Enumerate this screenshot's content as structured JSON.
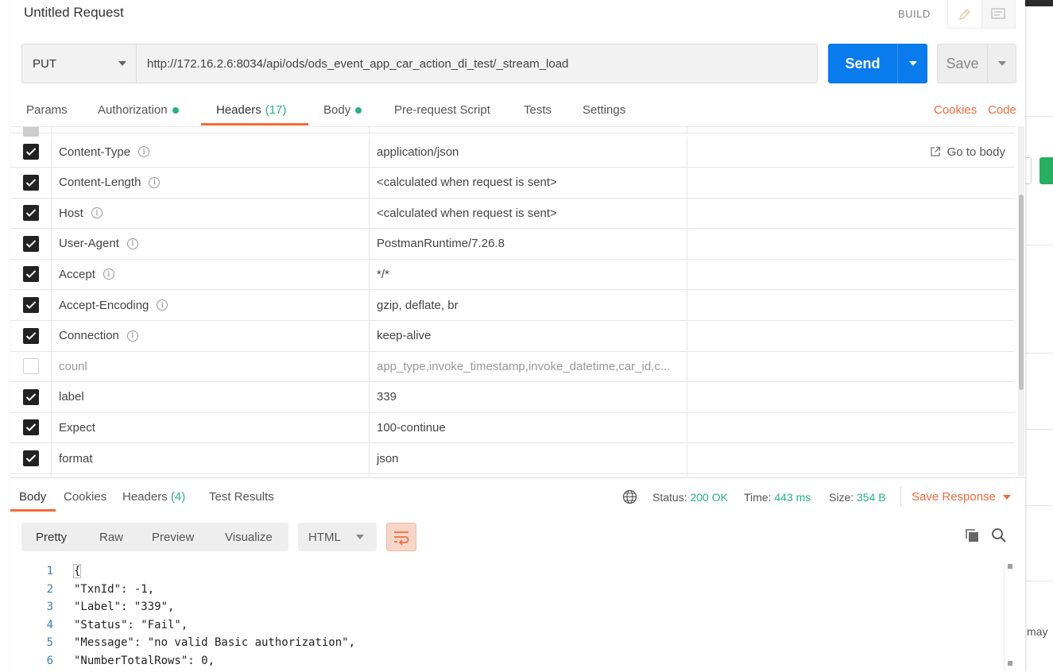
{
  "request": {
    "title": "Untitled Request",
    "mode_label": "BUILD",
    "method": "PUT",
    "url": "http://172.16.2.6:8034/api/ods/ods_event_app_car_action_di_test/_stream_load",
    "send_label": "Send",
    "save_label": "Save"
  },
  "request_tabs": {
    "params": "Params",
    "authorization": "Authorization",
    "headers": "Headers",
    "headers_count": "(17)",
    "body": "Body",
    "prerequest": "Pre-request Script",
    "tests": "Tests",
    "settings": "Settings",
    "cookies_link": "Cookies",
    "code_link": "Code"
  },
  "headers": {
    "go_to_body": "Go to body",
    "rows": [
      {
        "key": "Content-Type",
        "value": "application/json",
        "checked": true,
        "info": true
      },
      {
        "key": "Content-Length",
        "value": "<calculated when request is sent>",
        "checked": true,
        "info": true
      },
      {
        "key": "Host",
        "value": "<calculated when request is sent>",
        "checked": true,
        "info": true
      },
      {
        "key": "User-Agent",
        "value": "PostmanRuntime/7.26.8",
        "checked": true,
        "info": true
      },
      {
        "key": "Accept",
        "value": "*/*",
        "checked": true,
        "info": true
      },
      {
        "key": "Accept-Encoding",
        "value": "gzip, deflate, br",
        "checked": true,
        "info": true
      },
      {
        "key": "Connection",
        "value": "keep-alive",
        "checked": true,
        "info": true
      },
      {
        "key": "counl",
        "value": "app_type,invoke_timestamp,invoke_datetime,car_id,c...",
        "checked": false,
        "info": false
      },
      {
        "key": "label",
        "value": "339",
        "checked": true,
        "info": false
      },
      {
        "key": "Expect",
        "value": "100-continue",
        "checked": true,
        "info": false
      },
      {
        "key": "format",
        "value": "json",
        "checked": true,
        "info": false
      }
    ]
  },
  "response": {
    "tabs": {
      "body": "Body",
      "cookies": "Cookies",
      "headers": "Headers",
      "headers_count": "(4)",
      "test_results": "Test Results"
    },
    "status_label": "Status:",
    "status_value": "200 OK",
    "time_label": "Time:",
    "time_value": "443 ms",
    "size_label": "Size:",
    "size_value": "354 B",
    "save_response": "Save Response",
    "view_modes": [
      "Pretty",
      "Raw",
      "Preview",
      "Visualize"
    ],
    "format": "HTML",
    "lines": [
      {
        "n": "1",
        "text": "{"
      },
      {
        "n": "2",
        "text": "\"TxnId\": -1,"
      },
      {
        "n": "3",
        "text": "\"Label\": \"339\","
      },
      {
        "n": "4",
        "text": "\"Status\": \"Fail\","
      },
      {
        "n": "5",
        "text": "\"Message\": \"no valid Basic authorization\","
      },
      {
        "n": "6",
        "text": "\"NumberTotalRows\": 0,"
      }
    ]
  },
  "background": {
    "partial_text": "may"
  },
  "colors": {
    "accent": "#f26b3a",
    "send": "#097bed",
    "ok": "#26b47f"
  }
}
